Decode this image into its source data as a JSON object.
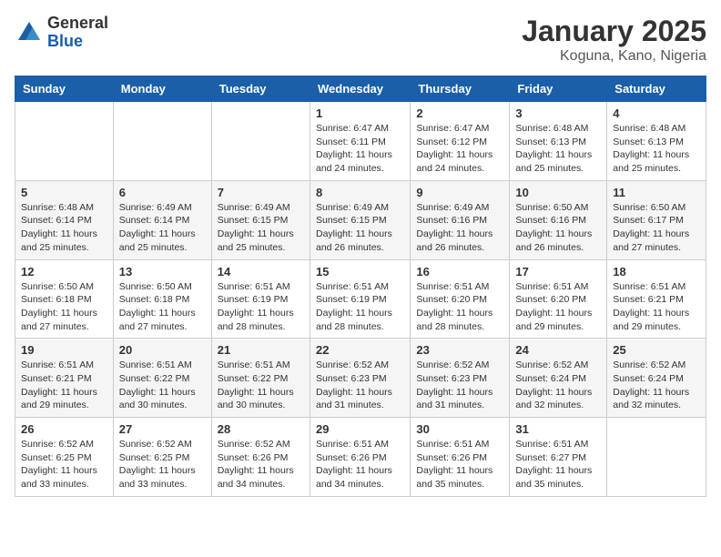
{
  "header": {
    "logo_general": "General",
    "logo_blue": "Blue",
    "title": "January 2025",
    "location": "Koguna, Kano, Nigeria"
  },
  "days_of_week": [
    "Sunday",
    "Monday",
    "Tuesday",
    "Wednesday",
    "Thursday",
    "Friday",
    "Saturday"
  ],
  "weeks": [
    [
      {
        "day": "",
        "info": ""
      },
      {
        "day": "",
        "info": ""
      },
      {
        "day": "",
        "info": ""
      },
      {
        "day": "1",
        "info": "Sunrise: 6:47 AM\nSunset: 6:11 PM\nDaylight: 11 hours and 24 minutes."
      },
      {
        "day": "2",
        "info": "Sunrise: 6:47 AM\nSunset: 6:12 PM\nDaylight: 11 hours and 24 minutes."
      },
      {
        "day": "3",
        "info": "Sunrise: 6:48 AM\nSunset: 6:13 PM\nDaylight: 11 hours and 25 minutes."
      },
      {
        "day": "4",
        "info": "Sunrise: 6:48 AM\nSunset: 6:13 PM\nDaylight: 11 hours and 25 minutes."
      }
    ],
    [
      {
        "day": "5",
        "info": "Sunrise: 6:48 AM\nSunset: 6:14 PM\nDaylight: 11 hours and 25 minutes."
      },
      {
        "day": "6",
        "info": "Sunrise: 6:49 AM\nSunset: 6:14 PM\nDaylight: 11 hours and 25 minutes."
      },
      {
        "day": "7",
        "info": "Sunrise: 6:49 AM\nSunset: 6:15 PM\nDaylight: 11 hours and 25 minutes."
      },
      {
        "day": "8",
        "info": "Sunrise: 6:49 AM\nSunset: 6:15 PM\nDaylight: 11 hours and 26 minutes."
      },
      {
        "day": "9",
        "info": "Sunrise: 6:49 AM\nSunset: 6:16 PM\nDaylight: 11 hours and 26 minutes."
      },
      {
        "day": "10",
        "info": "Sunrise: 6:50 AM\nSunset: 6:16 PM\nDaylight: 11 hours and 26 minutes."
      },
      {
        "day": "11",
        "info": "Sunrise: 6:50 AM\nSunset: 6:17 PM\nDaylight: 11 hours and 27 minutes."
      }
    ],
    [
      {
        "day": "12",
        "info": "Sunrise: 6:50 AM\nSunset: 6:18 PM\nDaylight: 11 hours and 27 minutes."
      },
      {
        "day": "13",
        "info": "Sunrise: 6:50 AM\nSunset: 6:18 PM\nDaylight: 11 hours and 27 minutes."
      },
      {
        "day": "14",
        "info": "Sunrise: 6:51 AM\nSunset: 6:19 PM\nDaylight: 11 hours and 28 minutes."
      },
      {
        "day": "15",
        "info": "Sunrise: 6:51 AM\nSunset: 6:19 PM\nDaylight: 11 hours and 28 minutes."
      },
      {
        "day": "16",
        "info": "Sunrise: 6:51 AM\nSunset: 6:20 PM\nDaylight: 11 hours and 28 minutes."
      },
      {
        "day": "17",
        "info": "Sunrise: 6:51 AM\nSunset: 6:20 PM\nDaylight: 11 hours and 29 minutes."
      },
      {
        "day": "18",
        "info": "Sunrise: 6:51 AM\nSunset: 6:21 PM\nDaylight: 11 hours and 29 minutes."
      }
    ],
    [
      {
        "day": "19",
        "info": "Sunrise: 6:51 AM\nSunset: 6:21 PM\nDaylight: 11 hours and 29 minutes."
      },
      {
        "day": "20",
        "info": "Sunrise: 6:51 AM\nSunset: 6:22 PM\nDaylight: 11 hours and 30 minutes."
      },
      {
        "day": "21",
        "info": "Sunrise: 6:51 AM\nSunset: 6:22 PM\nDaylight: 11 hours and 30 minutes."
      },
      {
        "day": "22",
        "info": "Sunrise: 6:52 AM\nSunset: 6:23 PM\nDaylight: 11 hours and 31 minutes."
      },
      {
        "day": "23",
        "info": "Sunrise: 6:52 AM\nSunset: 6:23 PM\nDaylight: 11 hours and 31 minutes."
      },
      {
        "day": "24",
        "info": "Sunrise: 6:52 AM\nSunset: 6:24 PM\nDaylight: 11 hours and 32 minutes."
      },
      {
        "day": "25",
        "info": "Sunrise: 6:52 AM\nSunset: 6:24 PM\nDaylight: 11 hours and 32 minutes."
      }
    ],
    [
      {
        "day": "26",
        "info": "Sunrise: 6:52 AM\nSunset: 6:25 PM\nDaylight: 11 hours and 33 minutes."
      },
      {
        "day": "27",
        "info": "Sunrise: 6:52 AM\nSunset: 6:25 PM\nDaylight: 11 hours and 33 minutes."
      },
      {
        "day": "28",
        "info": "Sunrise: 6:52 AM\nSunset: 6:26 PM\nDaylight: 11 hours and 34 minutes."
      },
      {
        "day": "29",
        "info": "Sunrise: 6:51 AM\nSunset: 6:26 PM\nDaylight: 11 hours and 34 minutes."
      },
      {
        "day": "30",
        "info": "Sunrise: 6:51 AM\nSunset: 6:26 PM\nDaylight: 11 hours and 35 minutes."
      },
      {
        "day": "31",
        "info": "Sunrise: 6:51 AM\nSunset: 6:27 PM\nDaylight: 11 hours and 35 minutes."
      },
      {
        "day": "",
        "info": ""
      }
    ]
  ]
}
